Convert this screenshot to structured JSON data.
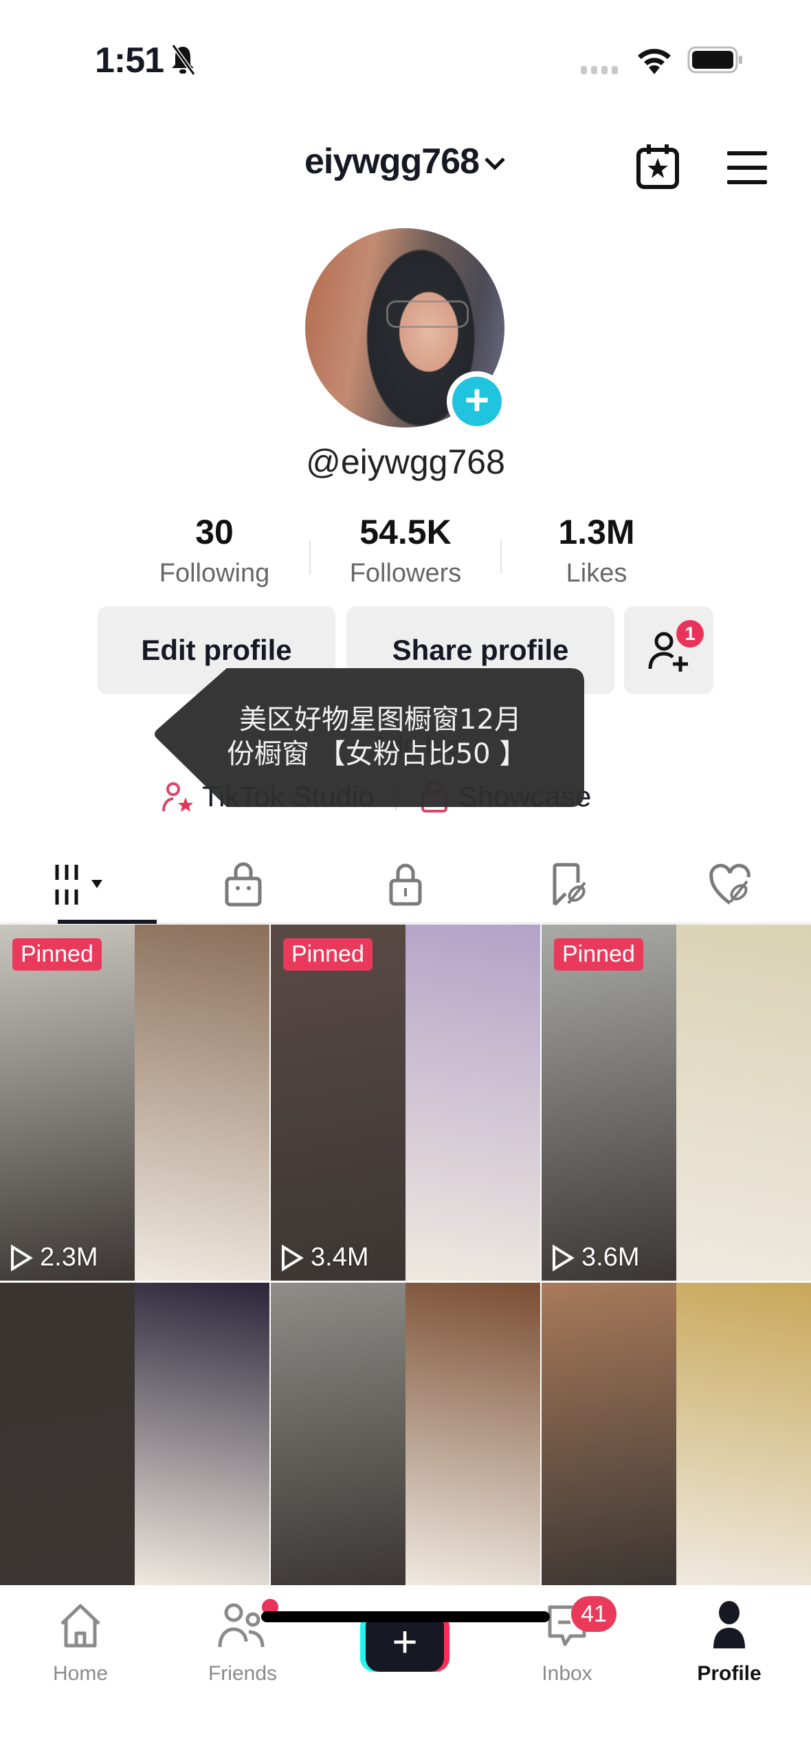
{
  "status_bar": {
    "time": "1:51"
  },
  "header": {
    "username": "eiywgg768"
  },
  "profile": {
    "handle": "@eiywgg768",
    "stats": [
      {
        "value": "30",
        "label": "Following"
      },
      {
        "value": "54.5K",
        "label": "Followers"
      },
      {
        "value": "1.3M",
        "label": "Likes"
      }
    ],
    "buttons": {
      "edit": "Edit profile",
      "share": "Share profile",
      "friend_requests_badge": "1"
    },
    "add_bio": "+ Add bio",
    "links": {
      "studio": "TikTok Studio",
      "showcase": "Showcase"
    }
  },
  "tooltip": {
    "text_line1": "美区好物星图橱窗12月",
    "text_line2": "份橱窗 【女粉占比50 】"
  },
  "tabs": [
    "videos",
    "shop",
    "private",
    "reposts",
    "liked"
  ],
  "videos": [
    {
      "pinned": true,
      "pinned_label": "Pinned",
      "views": "2.3M",
      "colors": [
        "#c9c6bf",
        "#8b6f5a"
      ]
    },
    {
      "pinned": true,
      "pinned_label": "Pinned",
      "views": "3.4M",
      "colors": [
        "#5a4a46",
        "#b2a2c8"
      ]
    },
    {
      "pinned": true,
      "pinned_label": "Pinned",
      "views": "3.6M",
      "colors": [
        "#a9aaa6",
        "#d9d2b4"
      ]
    },
    {
      "pinned": false,
      "views": "",
      "colors": [
        "#3a3330",
        "#2a2438"
      ]
    },
    {
      "pinned": false,
      "views": "",
      "colors": [
        "#8e8d88",
        "#7a4e33"
      ]
    },
    {
      "pinned": false,
      "views": "",
      "colors": [
        "#a87a5a",
        "#c8a85a"
      ]
    }
  ],
  "bottom_nav": {
    "home": "Home",
    "friends": "Friends",
    "inbox": "Inbox",
    "inbox_badge": "41",
    "profile": "Profile"
  },
  "colors": {
    "accent": "#fe2c55",
    "teal": "#20c4de",
    "pinned": "#ea3a5c"
  }
}
